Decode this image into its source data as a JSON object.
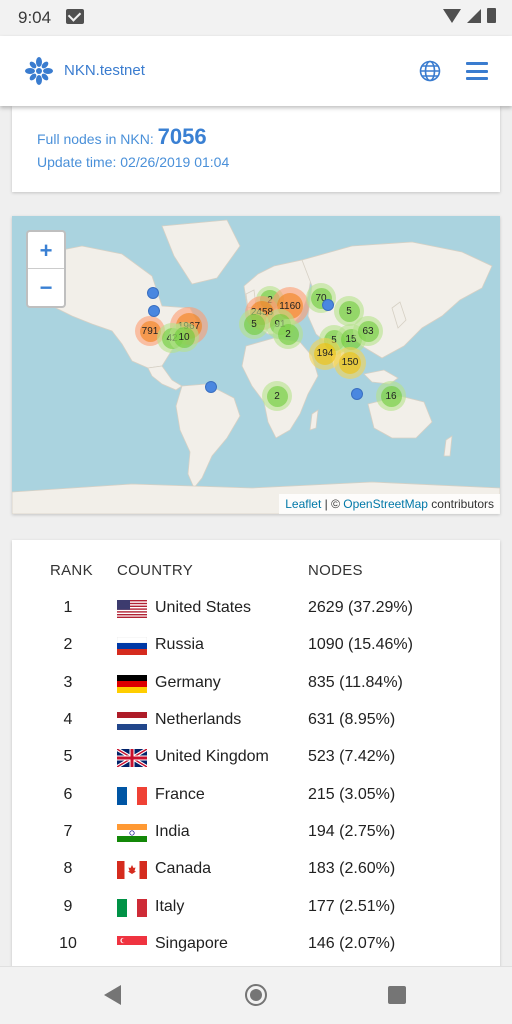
{
  "status_bar": {
    "time": "9:04",
    "icons": [
      "gmail-icon",
      "wifi-icon",
      "cell-signal-icon",
      "battery-icon"
    ]
  },
  "app_bar": {
    "title": "NKN.testnet",
    "icons": [
      "nkn-logo-icon",
      "globe-icon",
      "menu-icon"
    ],
    "accent_color": "#3a7ccf"
  },
  "summary": {
    "full_nodes_label": "Full nodes in NKN:",
    "full_nodes_count": "7056",
    "update_label": "Update time:",
    "update_time": "02/26/2019 01:04"
  },
  "map": {
    "zoom_in": "+",
    "zoom_out": "−",
    "clusters": [
      {
        "label": "791",
        "level": "orange"
      },
      {
        "label": "1967",
        "level": "orange"
      },
      {
        "label": "42",
        "level": "green"
      },
      {
        "label": "10",
        "level": "green"
      },
      {
        "label": "2",
        "level": "green"
      },
      {
        "label": "1160",
        "level": "orange"
      },
      {
        "label": "2458",
        "level": "orange"
      },
      {
        "label": "5",
        "level": "green"
      },
      {
        "label": "91",
        "level": "green"
      },
      {
        "label": "2",
        "level": "green"
      },
      {
        "label": "70",
        "level": "green"
      },
      {
        "label": "5",
        "level": "green"
      },
      {
        "label": "5",
        "level": "green"
      },
      {
        "label": "15",
        "level": "green"
      },
      {
        "label": "63",
        "level": "green"
      },
      {
        "label": "194",
        "level": "yellow"
      },
      {
        "label": "150",
        "level": "yellow"
      },
      {
        "label": "2",
        "level": "green"
      },
      {
        "label": "16",
        "level": "green"
      }
    ],
    "attribution": {
      "leaflet": "Leaflet",
      "sep": " | © ",
      "osm": "OpenStreetMap",
      "suffix": " contributors"
    }
  },
  "table": {
    "headers": {
      "rank": "RANK",
      "country": "COUNTRY",
      "nodes": "NODES"
    },
    "rows": [
      {
        "rank": "1",
        "country": "United States",
        "nodes": "2629 (37.29%)",
        "flag": "us-flag-icon"
      },
      {
        "rank": "2",
        "country": "Russia",
        "nodes": "1090 (15.46%)",
        "flag": "ru-flag-icon"
      },
      {
        "rank": "3",
        "country": "Germany",
        "nodes": "835 (11.84%)",
        "flag": "de-flag-icon"
      },
      {
        "rank": "4",
        "country": "Netherlands",
        "nodes": "631 (8.95%)",
        "flag": "nl-flag-icon"
      },
      {
        "rank": "5",
        "country": "United Kingdom",
        "nodes": "523 (7.42%)",
        "flag": "gb-flag-icon"
      },
      {
        "rank": "6",
        "country": "France",
        "nodes": "215 (3.05%)",
        "flag": "fr-flag-icon"
      },
      {
        "rank": "7",
        "country": "India",
        "nodes": "194 (2.75%)",
        "flag": "in-flag-icon"
      },
      {
        "rank": "8",
        "country": "Canada",
        "nodes": "183 (2.60%)",
        "flag": "ca-flag-icon"
      },
      {
        "rank": "9",
        "country": "Italy",
        "nodes": "177 (2.51%)",
        "flag": "it-flag-icon"
      },
      {
        "rank": "10",
        "country": "Singapore",
        "nodes": "146 (2.07%)",
        "flag": "sg-flag-icon"
      }
    ]
  },
  "nav_bar": {
    "icons": [
      "back-icon",
      "home-icon",
      "recent-apps-icon"
    ]
  }
}
